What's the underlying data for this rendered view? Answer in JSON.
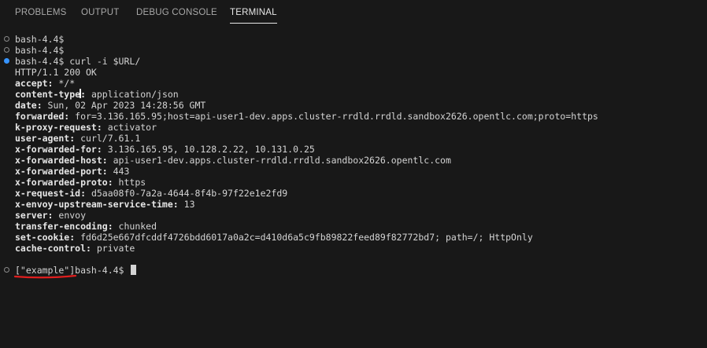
{
  "panel": {
    "tabs": [
      {
        "label": "PROBLEMS"
      },
      {
        "label": "OUTPUT"
      },
      {
        "label": "DEBUG CONSOLE"
      },
      {
        "label": "TERMINAL"
      }
    ],
    "active_tab": "TERMINAL"
  },
  "terminal": {
    "prompt_lines": [
      {
        "text": "bash-4.4$"
      },
      {
        "text": "bash-4.4$"
      },
      {
        "text": "bash-4.4$ curl -i $URL/"
      }
    ],
    "status_line": "HTTP/1.1 200 OK",
    "headers": [
      {
        "key": "accept:",
        "value": " */*"
      },
      {
        "key": "content-type:",
        "value": " application/json"
      },
      {
        "key": "date:",
        "value": " Sun, 02 Apr 2023 14:28:56 GMT"
      },
      {
        "key": "forwarded:",
        "value": " for=3.136.165.95;host=api-user1-dev.apps.cluster-rrdld.rrdld.sandbox2626.opentlc.com;proto=https"
      },
      {
        "key": "k-proxy-request:",
        "value": " activator"
      },
      {
        "key": "user-agent:",
        "value": " curl/7.61.1"
      },
      {
        "key": "x-forwarded-for:",
        "value": " 3.136.165.95, 10.128.2.22, 10.131.0.25"
      },
      {
        "key": "x-forwarded-host:",
        "value": " api-user1-dev.apps.cluster-rrdld.rrdld.sandbox2626.opentlc.com"
      },
      {
        "key": "x-forwarded-port:",
        "value": " 443"
      },
      {
        "key": "x-forwarded-proto:",
        "value": " https"
      },
      {
        "key": "x-request-id:",
        "value": " d5aa08f0-7a2a-4644-8f4b-97f22e1e2fd9"
      },
      {
        "key": "x-envoy-upstream-service-time:",
        "value": " 13"
      },
      {
        "key": "server:",
        "value": " envoy"
      },
      {
        "key": "transfer-encoding:",
        "value": " chunked"
      },
      {
        "key": "set-cookie:",
        "value": " fd6d25e667dfcddf4726bdd6017a0a2c=d410d6a5c9fb89822feed89f82772bd7; path=/; HttpOnly"
      },
      {
        "key": "cache-control:",
        "value": " private"
      }
    ],
    "final_prompt": "[\"example\"]bash-4.4$ ",
    "colors": {
      "background": "#181818",
      "foreground": "#d4d4d4",
      "decoration_success": "#3794ff",
      "annotation": "#e01e1e"
    }
  }
}
